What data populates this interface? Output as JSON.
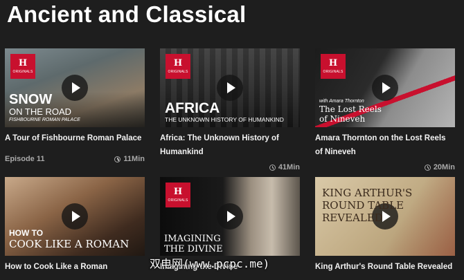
{
  "page": {
    "title": "Ancient and Classical"
  },
  "badge": {
    "letter": "H",
    "label": "ORIGINALS"
  },
  "cards": [
    {
      "title": "A Tour of Fishbourne Roman Palace",
      "episode": "Episode 11",
      "duration": "11Min",
      "thumb_text": {
        "line1": "SNOW",
        "line2": "ON THE ROAD",
        "line3": "FISHBOURNE ROMAN PALACE"
      }
    },
    {
      "title": "Africa: The Unknown History of Humankind",
      "duration": "41Min",
      "thumb_text": {
        "line1": "AFRICA",
        "line2": "THE UNKNOWN HISTORY OF HUMANKIND"
      }
    },
    {
      "title": "Amara Thornton on the Lost Reels of Nineveh",
      "duration": "20Min",
      "thumb_text": {
        "line1": "with Amara Thornton",
        "line2": "The Lost Reels",
        "line3": "of Nineveh"
      }
    },
    {
      "title": "How to Cook Like a Roman",
      "thumb_text": {
        "line1": "HOW TO",
        "line2": "COOK LIKE A ROMAN"
      }
    },
    {
      "title": "Imagining the Divine",
      "thumb_text": {
        "line1": "IMAGINING",
        "line2": "THE DIVINE"
      }
    },
    {
      "title": "King Arthur's Round Table Revealed",
      "thumb_text": {
        "line1": "KING ARTHUR'S",
        "line2": "ROUND TABLE",
        "line3": "REVEALED"
      }
    }
  ],
  "watermark": "双电网(www.pcpc.me)"
}
